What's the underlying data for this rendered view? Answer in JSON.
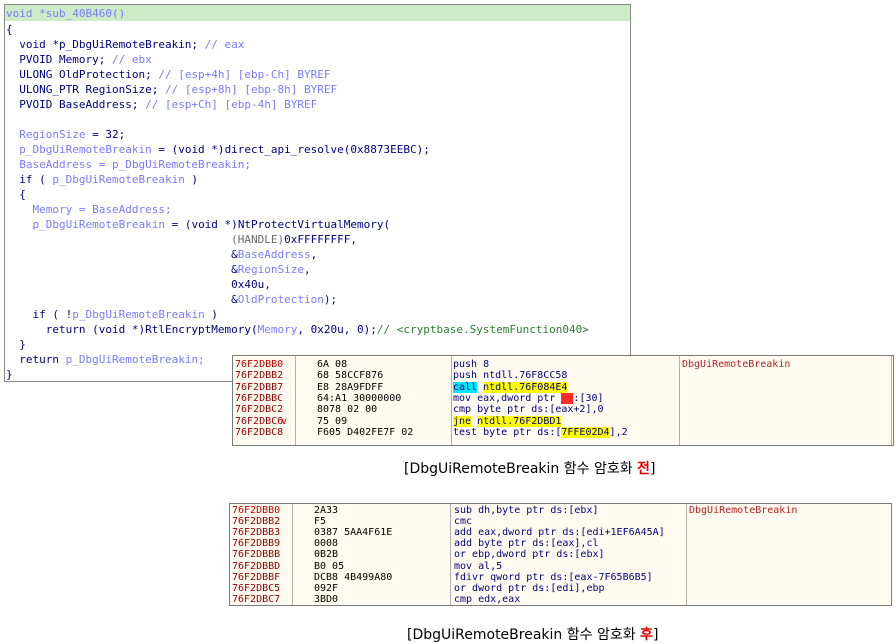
{
  "pseudocode": {
    "l1": "void *sub_40B460()",
    "l2": "{",
    "l3a": "  void *p_DbgUiRemoteBreakin;",
    "l3b": " // eax",
    "l4a": "  PVOID Memory;",
    "l4b": " // ebx",
    "l5a": "  ULONG OldProtection;",
    "l5b": " // [esp+4h] [ebp-Ch] BYREF",
    "l6a": "  ULONG_PTR RegionSize;",
    "l6b": " // [esp+8h] [ebp-8h] BYREF",
    "l7a": "  PVOID BaseAddress;",
    "l7b": " // [esp+Ch] [ebp-4h] BYREF",
    "l9a": "  RegionSize",
    "l9b": " = 32;",
    "l10a": "  p_DbgUiRemoteBreakin",
    "l10b": " = (void *)",
    "l10c": "direct_api_resolve(0x8873EEBC);",
    "l11a": "  BaseAddress = p_DbgUiRemoteBreakin;",
    "l12a": "  if ( ",
    "l12b": "p_DbgUiRemoteBreakin",
    "l12c": " )",
    "l13": "  {",
    "l14a": "    Memory = BaseAddress;",
    "l15a": "    p_DbgUiRemoteBreakin",
    "l15b": " = (void *)",
    "l15c": "NtProtectVirtualMemory(",
    "l16a": "                                  (HANDLE)",
    "l16b": "0xFFFFFFFF,",
    "l17a": "                                  &",
    "l17b": "BaseAddress",
    "l17c": ",",
    "l18a": "                                  &",
    "l18b": "RegionSize",
    "l18c": ",",
    "l19a": "                                  0x40u,",
    "l20a": "                                  &",
    "l20b": "OldProtection",
    "l20c": ");",
    "l21a": "    if ( !",
    "l21b": "p_DbgUiRemoteBreakin",
    "l21c": " )",
    "l22a": "      return (void *)",
    "l22b": "RtlEncryptMemory(",
    "l22c": "Memory",
    "l22d": ", 0x20u, 0);",
    "l22e": "// <cryptbase.SystemFunction040>",
    "l23": "  }",
    "l24a": "  return ",
    "l24b": "p_DbgUiRemoteBreakin;",
    "l25": "}"
  },
  "before": {
    "comment": "DbgUiRemoteBreakin",
    "rows": [
      {
        "addr": "76F2DBB0",
        "bytes": "6A 08",
        "instr": "push 8"
      },
      {
        "addr": "76F2DBB2",
        "bytes": "68 58CCF876",
        "instr": "push ntdll.76F8CC58"
      },
      {
        "addr": "76F2DBB7",
        "bytes": "E8 28A9FDFF",
        "instr_a": "call",
        "instr_b": " ",
        "instr_c": "ntdll.76F084E4"
      },
      {
        "addr": "76F2DBBC",
        "bytes": "64:A1 30000000",
        "instr_a": "mov eax,dword ptr ",
        "instr_b": "fs",
        "instr_c": ":[30]"
      },
      {
        "addr": "76F2DBC2",
        "bytes": "8078 02 00",
        "instr": "cmp byte ptr ds:[eax+2],0"
      },
      {
        "addr": "76F2DBC6",
        "arrow": "v",
        "bytes": "75 09",
        "instr_a": "jne",
        "instr_b": " ",
        "instr_c": "ntdll.76F2DBD1"
      },
      {
        "addr": "76F2DBC8",
        "bytes": "F605 D402FE7F 02",
        "instr_a": "test byte ptr ds:[",
        "instr_b": "7FFE02D4",
        "instr_c": "],2"
      }
    ],
    "caption_a": "[DbgUiRemoteBreakin 함수 암호화 ",
    "caption_b": "전",
    "caption_c": "]"
  },
  "after": {
    "comment": "DbgUiRemoteBreakin",
    "rows": [
      {
        "addr": "76F2DBB0",
        "bytes": "2A33",
        "instr": "sub dh,byte ptr ds:[ebx]"
      },
      {
        "addr": "76F2DBB2",
        "bytes": "F5",
        "instr": "cmc"
      },
      {
        "addr": "76F2DBB3",
        "bytes": "0387 5AA4F61E",
        "instr": "add eax,dword ptr ds:[edi+1EF6A45A]"
      },
      {
        "addr": "76F2DBB9",
        "bytes": "0008",
        "instr": "add byte ptr ds:[eax],cl"
      },
      {
        "addr": "76F2DBBB",
        "bytes": "0B2B",
        "instr": "or ebp,dword ptr ds:[ebx]"
      },
      {
        "addr": "76F2DBBD",
        "bytes": "B0 05",
        "instr": "mov al,5"
      },
      {
        "addr": "76F2DBBF",
        "bytes": "DCB8 4B499A80",
        "instr": "fdivr qword ptr ds:[eax-7F65B6B5]"
      },
      {
        "addr": "76F2DBC5",
        "bytes": "092F",
        "instr": "or dword ptr ds:[edi],ebp"
      },
      {
        "addr": "76F2DBC7",
        "bytes": "3BD0",
        "instr": "cmp edx,eax"
      }
    ],
    "caption_a": "[DbgUiRemoteBreakin 함수 암호화 ",
    "caption_b": "후",
    "caption_c": "]"
  },
  "colors": {
    "accent_red": "#e00000",
    "highlight_green": "#ccebc6",
    "call_cyan": "#00e5ff",
    "jump_yellow": "#ffff00"
  }
}
